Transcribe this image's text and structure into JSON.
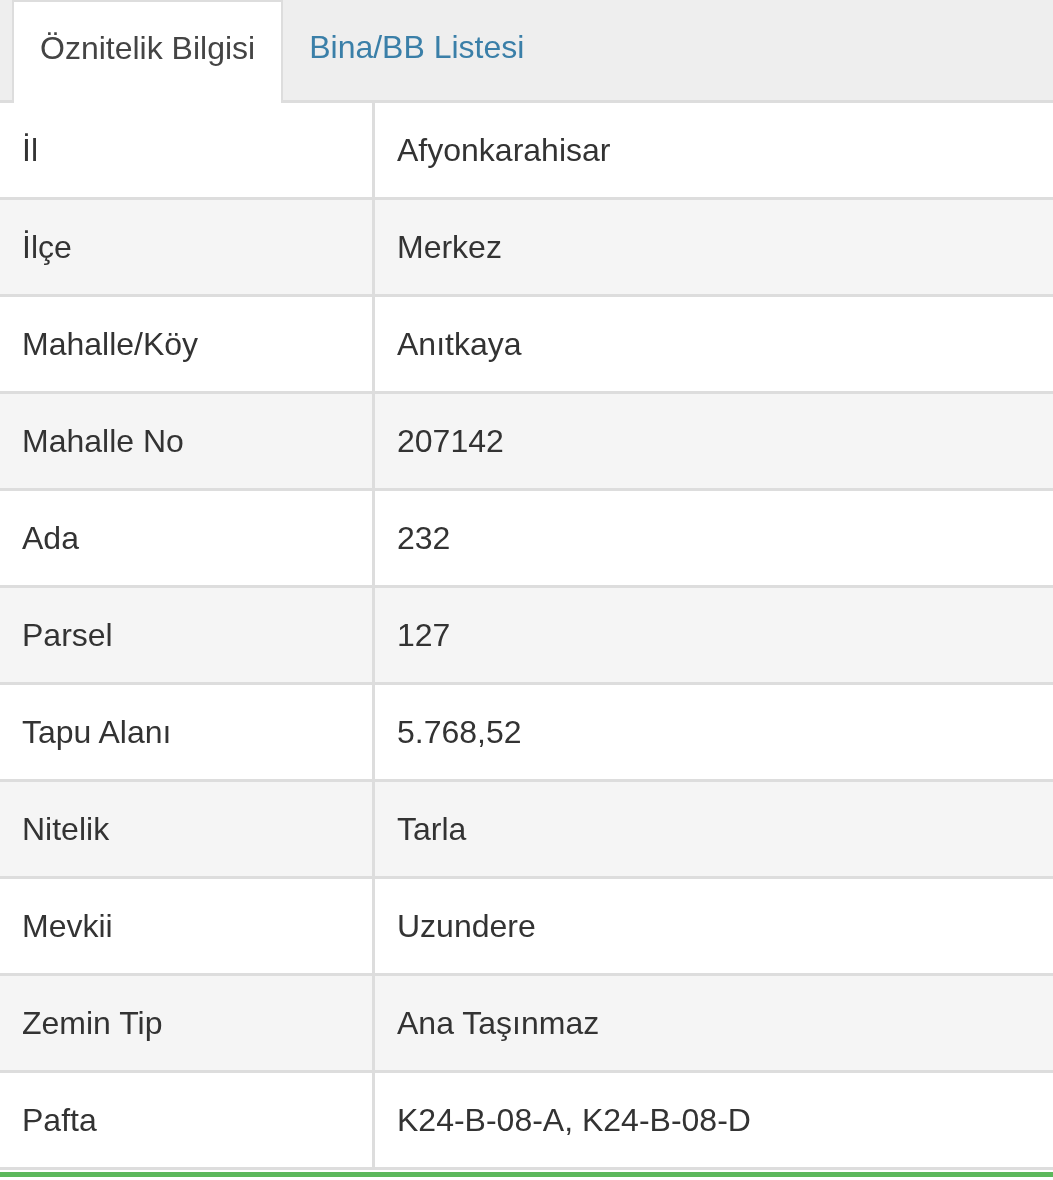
{
  "tabs": [
    {
      "label": "Öznitelik Bilgisi",
      "selected": true
    },
    {
      "label": "Bina/BB Listesi",
      "selected": false
    }
  ],
  "table": {
    "rows": [
      {
        "label": "İl",
        "value": "Afyonkarahisar"
      },
      {
        "label": "İlçe",
        "value": "Merkez"
      },
      {
        "label": "Mahalle/Köy",
        "value": "Anıtkaya"
      },
      {
        "label": "Mahalle No",
        "value": "207142"
      },
      {
        "label": "Ada",
        "value": "232"
      },
      {
        "label": "Parsel",
        "value": "127"
      },
      {
        "label": "Tapu Alanı",
        "value": "5.768,52"
      },
      {
        "label": "Nitelik",
        "value": "Tarla"
      },
      {
        "label": "Mevkii",
        "value": "Uzundere"
      },
      {
        "label": "Zemin Tip",
        "value": "Ana Taşınmaz"
      },
      {
        "label": "Pafta",
        "value": "K24-B-08-A, K24-B-08-D"
      }
    ]
  }
}
